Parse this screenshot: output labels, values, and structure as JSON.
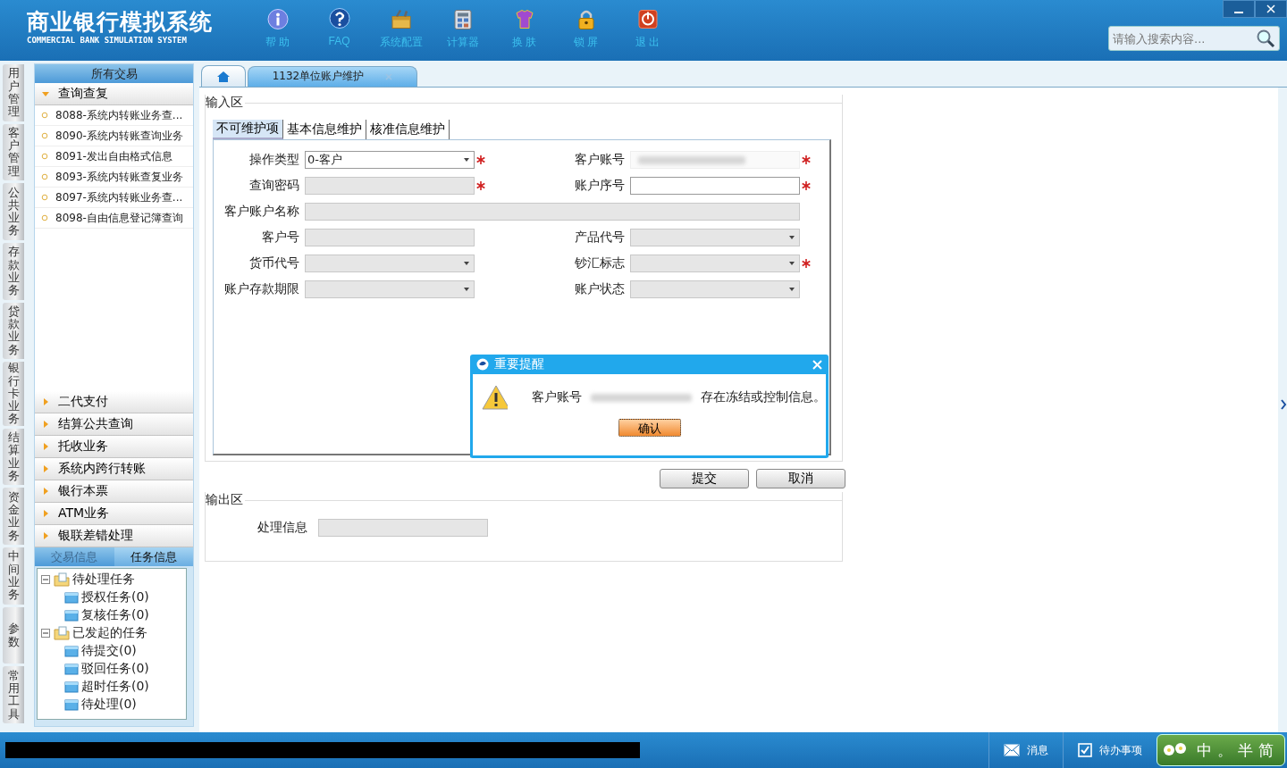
{
  "header": {
    "title": "商业银行模拟系统",
    "subtitle": "COMMERCIAL BANK SIMULATION SYSTEM",
    "toolbar": [
      {
        "label": "帮 助",
        "kind": "info"
      },
      {
        "label": "FAQ",
        "kind": "faq"
      },
      {
        "label": "系统配置",
        "kind": "config"
      },
      {
        "label": "计算器",
        "kind": "calc"
      },
      {
        "label": "换 肤",
        "kind": "skin"
      },
      {
        "label": "锁 屏",
        "kind": "lock"
      },
      {
        "label": "退 出",
        "kind": "exit"
      }
    ],
    "search": {
      "placeholder": "请输入搜索内容..."
    }
  },
  "left_tabs": [
    "用户管理",
    "客户管理",
    "公共业务",
    "存款业务",
    "贷款业务",
    "银行卡业务",
    "结算业务",
    "资金业务",
    "中间业务",
    "参数",
    "常用工具"
  ],
  "sidebar": {
    "title": "所有交易",
    "groups": [
      {
        "label": "查询查复",
        "expanded": true,
        "items": [
          "8088-系统内转账业务查...",
          "8090-系统内转账查询业务",
          "8091-发出自由格式信息",
          "8093-系统内转账查复业务",
          "8097-系统内转账业务查...",
          "8098-自由信息登记簿查询"
        ]
      },
      {
        "label": "二代支付",
        "expanded": false
      },
      {
        "label": "结算公共查询",
        "expanded": false
      },
      {
        "label": "托收业务",
        "expanded": false
      },
      {
        "label": "系统内跨行转账",
        "expanded": false
      },
      {
        "label": "银行本票",
        "expanded": false
      },
      {
        "label": "ATM业务",
        "expanded": false
      },
      {
        "label": "银联差错处理",
        "expanded": false
      }
    ],
    "info_tabs": [
      {
        "label": "交易信息",
        "selected": false
      },
      {
        "label": "任务信息",
        "selected": true
      }
    ],
    "tree": [
      {
        "label": "待处理任务",
        "expanded": true,
        "children": [
          {
            "label": "授权任务(0)"
          },
          {
            "label": "复核任务(0)"
          }
        ]
      },
      {
        "label": "已发起的任务",
        "expanded": true,
        "children": [
          {
            "label": "待提交(0)"
          },
          {
            "label": "驳回任务(0)"
          },
          {
            "label": "超时任务(0)"
          },
          {
            "label": "待处理(0)"
          }
        ]
      }
    ]
  },
  "tabs": [
    {
      "kind": "home",
      "selected": false
    },
    {
      "kind": "page",
      "label": "1132单位账户维护",
      "selected": true
    }
  ],
  "input_area": {
    "legend": "输入区",
    "subtabs": [
      {
        "label": "不可维护项",
        "selected": true
      },
      {
        "label": "基本信息维护",
        "selected": false
      },
      {
        "label": "核准信息维护",
        "selected": false
      }
    ],
    "fields": [
      {
        "label": "操作类型",
        "kind": "select",
        "value": "0-客户",
        "disabled": false,
        "required": true
      },
      {
        "label": "客户账号",
        "kind": "masked",
        "disabled": true,
        "required": true
      },
      {
        "label": "查询密码",
        "kind": "text",
        "disabled": true,
        "required": true
      },
      {
        "label": "账户序号",
        "kind": "text",
        "disabled": false,
        "required": true
      },
      {
        "label": "客户账户名称",
        "kind": "wide",
        "disabled": true,
        "required": false
      },
      {
        "label": "客户号",
        "kind": "text",
        "disabled": true,
        "required": false
      },
      {
        "label": "产品代号",
        "kind": "select",
        "disabled": true,
        "required": false
      },
      {
        "label": "货币代号",
        "kind": "select",
        "disabled": true,
        "required": false
      },
      {
        "label": "钞汇标志",
        "kind": "select",
        "disabled": true,
        "required": true
      },
      {
        "label": "账户存款期限",
        "kind": "select",
        "disabled": true,
        "required": false
      },
      {
        "label": "账户状态",
        "kind": "select",
        "disabled": true,
        "required": false
      }
    ]
  },
  "buttons": [
    "提交",
    "取消"
  ],
  "output_area": {
    "legend": "输出区",
    "field": {
      "label": "处理信息",
      "disabled": true
    }
  },
  "dialog": {
    "title": "重要提醒",
    "message_before": "客户账号",
    "message_after": "存在冻结或控制信息。",
    "button": "确认"
  },
  "status_bar": {
    "items": [
      {
        "label": "消息",
        "kind": "message"
      },
      {
        "label": "待办事项",
        "kind": "todo"
      }
    ],
    "ime": [
      "中",
      "。",
      "半",
      "简"
    ]
  }
}
